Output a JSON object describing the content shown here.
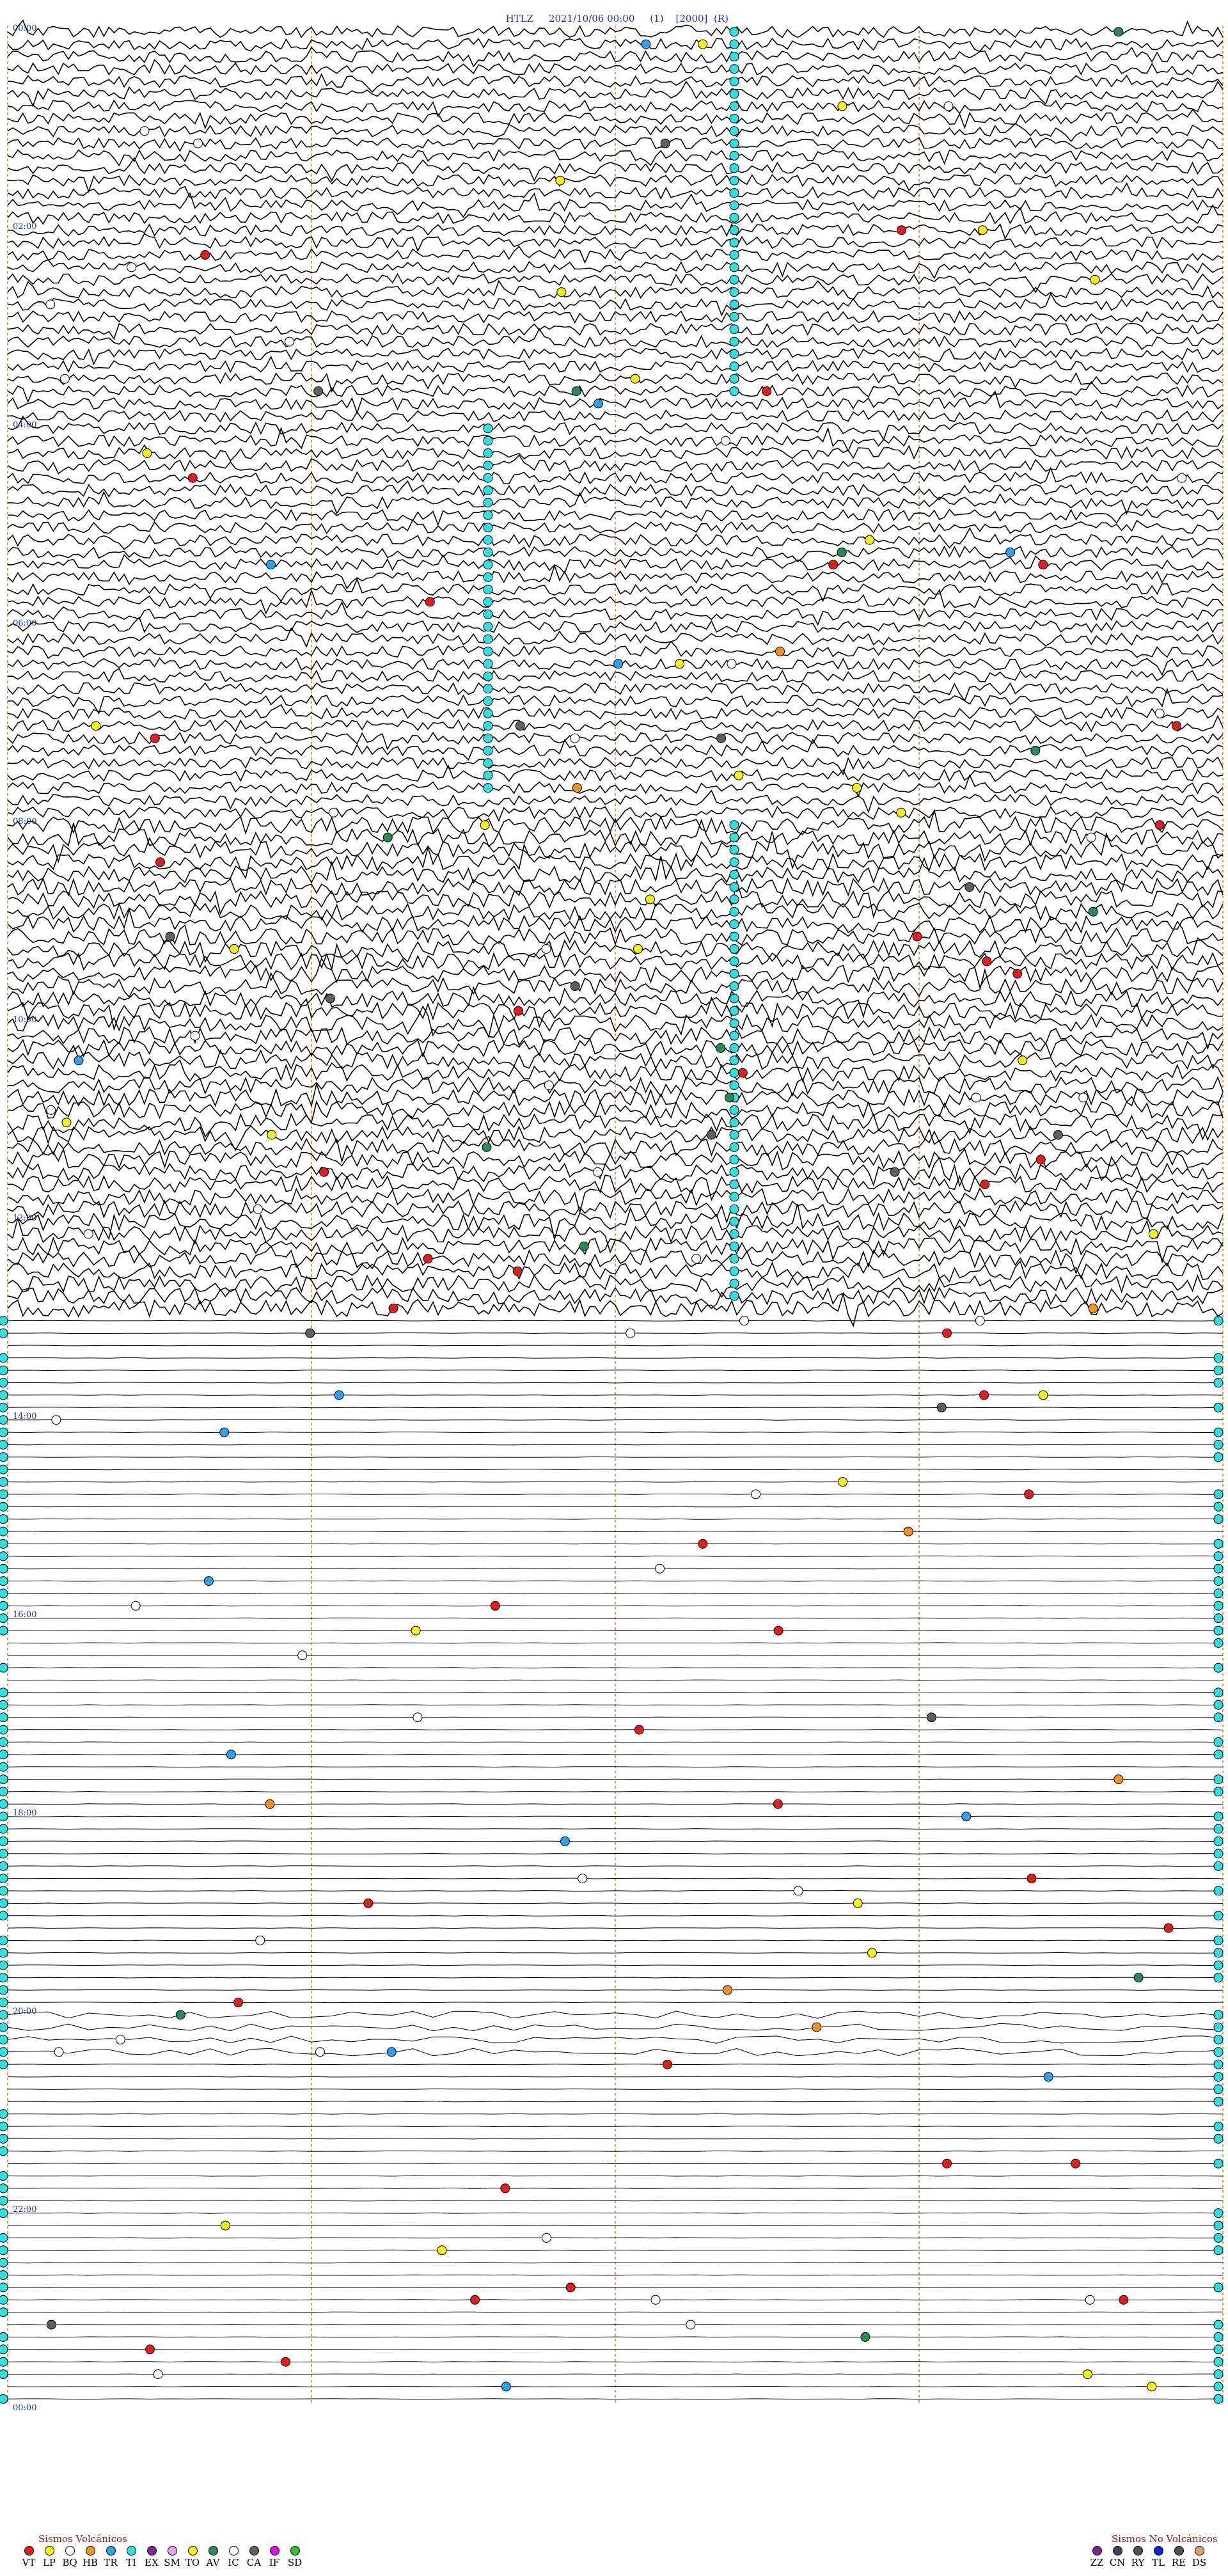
{
  "header": {
    "station": "HTLZ",
    "datetime": "2021/10/06 00:00",
    "flag1": "(1)",
    "scale": "[2000]",
    "flag2": "(R)"
  },
  "chart_data": {
    "type": "seismogram-helicorder",
    "title": "HTLZ    2021/10/06 00:00    (1)    [2000]  (R)",
    "hour_labels": [
      "00:00",
      "02:00",
      "04:00",
      "06:00",
      "08:00",
      "10:00",
      "12:00",
      "14:00",
      "16:00",
      "18:00",
      "20:00",
      "22:00",
      "00:00"
    ],
    "traces_per_hour": 8,
    "hours_displayed": 24,
    "minute_markers": [
      15,
      30,
      45
    ],
    "marker_line_color": "#e2733a",
    "trace_color": "#000000",
    "active_signal_hours": [
      0,
      13
    ],
    "quiet_hours": [
      13.5,
      24
    ],
    "event_types_volcanic": [
      {
        "code": "VT",
        "color": "#e02020"
      },
      {
        "code": "LP",
        "color": "#f5f016"
      },
      {
        "code": "BQ",
        "color": "#ffffff"
      },
      {
        "code": "HB",
        "color": "#f59120"
      },
      {
        "code": "TR",
        "color": "#30a0f0"
      },
      {
        "code": "TI",
        "color": "#30e0e0"
      },
      {
        "code": "EX",
        "color": "#7b2a8a"
      },
      {
        "code": "SM",
        "color": "#e8a0e8"
      },
      {
        "code": "TO",
        "color": "#f5e616"
      },
      {
        "code": "AV",
        "color": "#2a8a5a"
      },
      {
        "code": "IC",
        "color": "#ffffff"
      },
      {
        "code": "CA",
        "color": "#606060"
      },
      {
        "code": "IF",
        "color": "#e010e0"
      },
      {
        "code": "SD",
        "color": "#30c030"
      }
    ],
    "event_types_non_volcanic": [
      {
        "code": "ZZ",
        "color": "#7b2a8a"
      },
      {
        "code": "CN",
        "color": "#404060"
      },
      {
        "code": "RY",
        "color": "#505050"
      },
      {
        "code": "TL",
        "color": "#1020e0"
      },
      {
        "code": "RE",
        "color": "#505050"
      },
      {
        "code": "DS",
        "color": "#d8a070"
      }
    ]
  },
  "legend": {
    "volcanic_title": "Sismos Volcánicos",
    "non_volcanic_title": "Sismos No Volcánicos"
  }
}
